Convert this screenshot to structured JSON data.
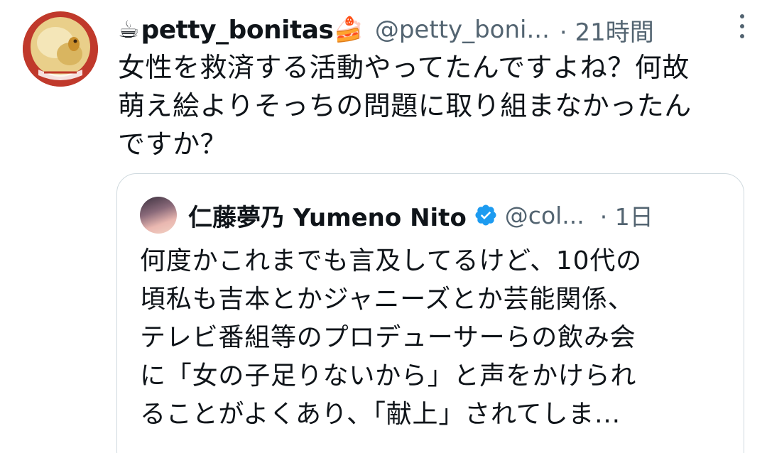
{
  "tweet": {
    "name_prefix_emoji": "☕",
    "display_name": "petty_bonitas",
    "name_suffix_emoji": "🍰",
    "handle": "@petty_boni...",
    "time": "· 21時間",
    "body_lines": [
      "女性を救済する活動やってたんですよね？何故",
      "萌え絵よりそっちの問題に取り組まなかったん",
      "ですか？"
    ]
  },
  "quoted": {
    "display_name": "仁藤夢乃 Yumeno Nito",
    "handle": "@col...",
    "time": "· 1日",
    "verified": true,
    "body_lines": [
      "何度かこれまでも言及してるけど、10代の",
      "頃私も吉本とかジャニーズとか芸能関係、",
      "テレビ番組等のプロデューサーらの飲み会",
      "に「女の子足りないから」と声をかけられ",
      "ることがよくあり、「献上」されてしま..."
    ]
  },
  "colors": {
    "text": "#0f1419",
    "secondary": "#536471",
    "border": "#cfd9de",
    "verified_blue": "#1d9bf0"
  },
  "icons": {
    "more": "more-options-icon",
    "verified": "verified-badge-icon"
  }
}
